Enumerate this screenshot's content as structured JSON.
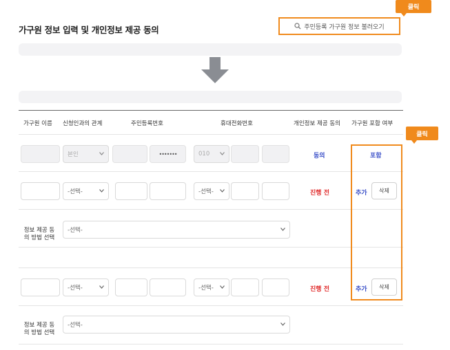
{
  "page": {
    "title": "가구원 정보 입력 및 개인정보 제공 동의",
    "search_button": "주민등록 가구원 정보 불러오기",
    "click_badge": "클릭"
  },
  "table": {
    "headers": [
      "가구원 이름",
      "신청인과의 관계",
      "주민등록번호",
      "휴대전화번호",
      "개인정보 제공 동의",
      "가구원 포함 여부"
    ]
  },
  "rows": [
    {
      "relation": "본인",
      "rrn_masked": "•••••••",
      "phone_prefix": "010",
      "consent_status": "동의",
      "include_status": "포함"
    },
    {
      "relation": "-선택-",
      "phone_prefix": "-선택-",
      "consent_status": "진행 전",
      "add_label": "추가",
      "delete_label": "삭제",
      "consent_method_label": "정보 제공 동의 방법 선택",
      "consent_method_value": "-선택-"
    },
    {
      "relation": "-선택-",
      "phone_prefix": "-선택-",
      "consent_status": "진행 전",
      "add_label": "추가",
      "delete_label": "삭제",
      "consent_method_label": "정보 제공 동의 방법 선택",
      "consent_method_value": "-선택-"
    }
  ],
  "colors": {
    "accent": "#f08a1c",
    "blue": "#3a4fc8",
    "red": "#e02d2d"
  }
}
